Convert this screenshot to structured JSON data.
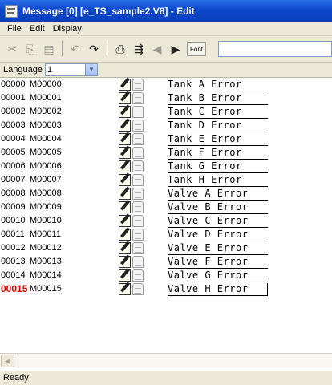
{
  "window": {
    "title": "Message [0] [e_TS_sample2.V8] - Edit"
  },
  "menu": {
    "items": [
      "File",
      "Edit",
      "Display"
    ]
  },
  "toolbar": {
    "font_label": "Font",
    "input_value": ""
  },
  "language": {
    "label": "Language",
    "value": "1"
  },
  "rows": [
    {
      "no": "00000",
      "id": "M00000",
      "message": "Tank A Error"
    },
    {
      "no": "00001",
      "id": "M00001",
      "message": "Tank B Error"
    },
    {
      "no": "00002",
      "id": "M00002",
      "message": "Tank C Error"
    },
    {
      "no": "00003",
      "id": "M00003",
      "message": "Tank D Error"
    },
    {
      "no": "00004",
      "id": "M00004",
      "message": "Tank E Error"
    },
    {
      "no": "00005",
      "id": "M00005",
      "message": "Tank F Error"
    },
    {
      "no": "00006",
      "id": "M00006",
      "message": "Tank G Error"
    },
    {
      "no": "00007",
      "id": "M00007",
      "message": "Tank H Error"
    },
    {
      "no": "00008",
      "id": "M00008",
      "message": "Valve A Error"
    },
    {
      "no": "00009",
      "id": "M00009",
      "message": "Valve B Error"
    },
    {
      "no": "00010",
      "id": "M00010",
      "message": "Valve C Error"
    },
    {
      "no": "00011",
      "id": "M00011",
      "message": "Valve D Error"
    },
    {
      "no": "00012",
      "id": "M00012",
      "message": "Valve E Error"
    },
    {
      "no": "00013",
      "id": "M00013",
      "message": "Valve F Error"
    },
    {
      "no": "00014",
      "id": "M00014",
      "message": "Valve G Error"
    },
    {
      "no": "00015",
      "id": "M00015",
      "message": "Valve H Error",
      "active": true
    }
  ],
  "status": {
    "text": "Ready"
  }
}
